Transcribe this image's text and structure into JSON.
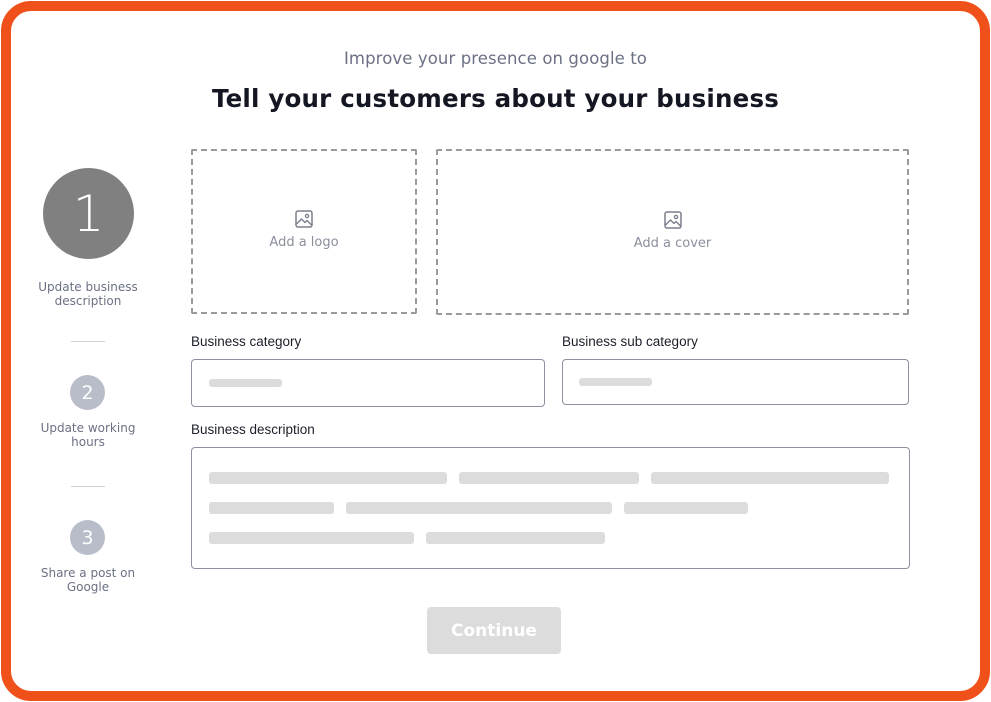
{
  "header": {
    "subtitle": "Improve your presence on google to",
    "title": "Tell your customers about your business"
  },
  "steps": [
    {
      "number": "1",
      "label": "Update business description",
      "state": "active"
    },
    {
      "number": "2",
      "label": "Update working hours",
      "state": "inactive"
    },
    {
      "number": "3",
      "label": "Share a post on Google",
      "state": "inactive"
    }
  ],
  "uploads": {
    "logo_label": "Add a logo",
    "cover_label": "Add a cover",
    "icon": "image-icon"
  },
  "form": {
    "category_label": "Business category",
    "sub_category_label": "Business sub category",
    "description_label": "Business description"
  },
  "actions": {
    "continue_label": "Continue"
  },
  "colors": {
    "frame": "#f0501a",
    "active_step": "#808080",
    "inactive_step": "#b9bdc9",
    "disabled_button": "#dcdcdc"
  }
}
